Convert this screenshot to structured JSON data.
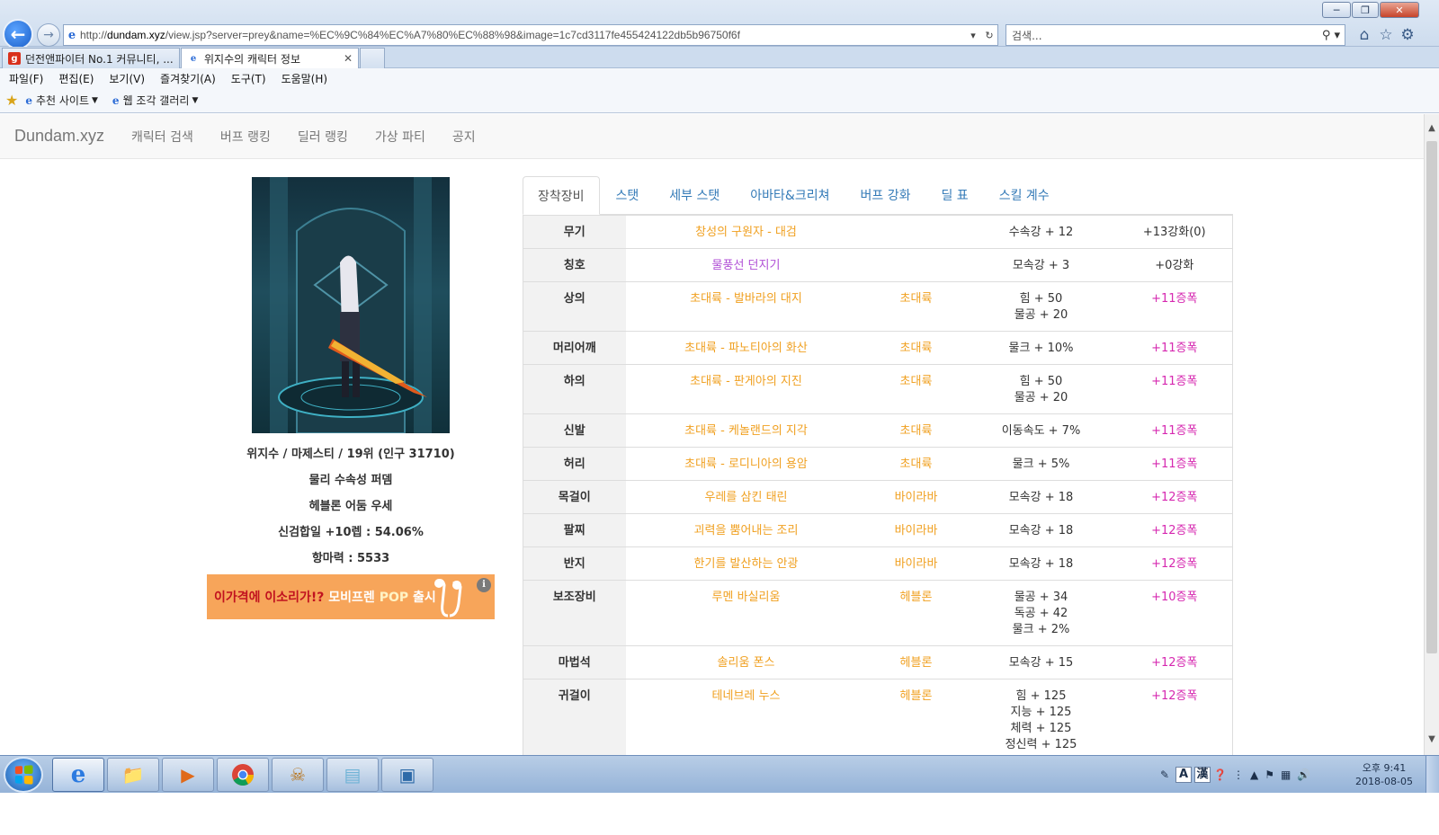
{
  "browser": {
    "url_prefix": "http://",
    "url_host": "dundam.xyz",
    "url_rest": "/view.jsp?server=prey&name=%EC%9C%84%EC%A7%80%EC%88%98&image=1c7cd3117fe455424122db5b96750f6f",
    "search_placeholder": "검색...",
    "tabs": [
      {
        "label": "던전앤파이터 No.1 커뮤니티, ..."
      },
      {
        "label": "위지수의 캐릭터 정보"
      }
    ],
    "menu": [
      "파일(F)",
      "편집(E)",
      "보기(V)",
      "즐겨찾기(A)",
      "도구(T)",
      "도움말(H)"
    ],
    "favorites": [
      "추천 사이트",
      "웹 조각 갤러리"
    ]
  },
  "site": {
    "brand": "Dundam.xyz",
    "nav": [
      "캐릭터 검색",
      "버프 랭킹",
      "딜러 랭킹",
      "가상 파티",
      "공지"
    ]
  },
  "character": {
    "summary": "위지수 / 마제스티 / 19위 (인구 31710)",
    "line2": "물리 수속성 퍼뎀",
    "line3": "헤블론 어둠 우세",
    "line4": "신검합일 +10렙 : 54.06%",
    "line5": "항마력 : 5533"
  },
  "ad": {
    "part1": "이가격에 이소리가!? ",
    "part2": "모비프렌 ",
    "part3": "POP",
    "part4": " 출시",
    "info": "i"
  },
  "equip_tabs": [
    "장착장비",
    "스탯",
    "세부 스탯",
    "아바타&크리쳐",
    "버프 강화",
    "딜 표",
    "스킬 계수"
  ],
  "equipment": [
    {
      "slot": "무기",
      "name": "창성의 구원자 - 대검",
      "set": "",
      "stats": [
        "수속강 + 12"
      ],
      "enhance": "+13강화(0)",
      "name_color": "orange",
      "enh_plain": true
    },
    {
      "slot": "칭호",
      "name": "물풍선 던지기",
      "set": "",
      "stats": [
        "모속강 + 3"
      ],
      "enhance": "+0강화",
      "name_color": "purple",
      "enh_plain": true
    },
    {
      "slot": "상의",
      "name": "초대륙 - 발바라의 대지",
      "set": "초대륙",
      "stats": [
        "힘 + 50",
        "물공 + 20"
      ],
      "enhance": "+11증폭",
      "name_color": "orange",
      "enh_plain": false
    },
    {
      "slot": "머리어깨",
      "name": "초대륙 - 파노티아의 화산",
      "set": "초대륙",
      "stats": [
        "물크 + 10%"
      ],
      "enhance": "+11증폭",
      "name_color": "orange",
      "enh_plain": false
    },
    {
      "slot": "하의",
      "name": "초대륙 - 판게아의 지진",
      "set": "초대륙",
      "stats": [
        "힘 + 50",
        "물공 + 20"
      ],
      "enhance": "+11증폭",
      "name_color": "orange",
      "enh_plain": false
    },
    {
      "slot": "신발",
      "name": "초대륙 - 케놀랜드의 지각",
      "set": "초대륙",
      "stats": [
        "이동속도 + 7%"
      ],
      "enhance": "+11증폭",
      "name_color": "orange",
      "enh_plain": false
    },
    {
      "slot": "허리",
      "name": "초대륙 - 로디니아의 용암",
      "set": "초대륙",
      "stats": [
        "물크 + 5%"
      ],
      "enhance": "+11증폭",
      "name_color": "orange",
      "enh_plain": false
    },
    {
      "slot": "목걸이",
      "name": "우레를 삼킨 태린",
      "set": "바이라바",
      "stats": [
        "모속강 + 18"
      ],
      "enhance": "+12증폭",
      "name_color": "orange",
      "enh_plain": false
    },
    {
      "slot": "팔찌",
      "name": "괴력을 뿜어내는 조리",
      "set": "바이라바",
      "stats": [
        "모속강 + 18"
      ],
      "enhance": "+12증폭",
      "name_color": "orange",
      "enh_plain": false
    },
    {
      "slot": "반지",
      "name": "한기를 발산하는 안광",
      "set": "바이라바",
      "stats": [
        "모속강 + 18"
      ],
      "enhance": "+12증폭",
      "name_color": "orange",
      "enh_plain": false
    },
    {
      "slot": "보조장비",
      "name": "루멘 바실리움",
      "set": "헤블론",
      "stats": [
        "물공 + 34",
        "독공 + 42",
        "물크 + 2%"
      ],
      "enhance": "+10증폭",
      "name_color": "orange",
      "enh_plain": false
    },
    {
      "slot": "마법석",
      "name": "솔리움 폰스",
      "set": "헤블론",
      "stats": [
        "모속강 + 15"
      ],
      "enhance": "+12증폭",
      "name_color": "orange",
      "enh_plain": false
    },
    {
      "slot": "귀걸이",
      "name": "테네브레 누스",
      "set": "헤블론",
      "stats": [
        "힘 + 125",
        "지능 + 125",
        "체력 + 125",
        "정신력 + 125"
      ],
      "enhance": "+12증폭",
      "name_color": "orange",
      "enh_plain": false
    }
  ],
  "taskbar": {
    "clock_ampm": "오후 9:41",
    "clock_date": "2018-08-05",
    "ime_a": "A",
    "ime_han": "漢"
  }
}
